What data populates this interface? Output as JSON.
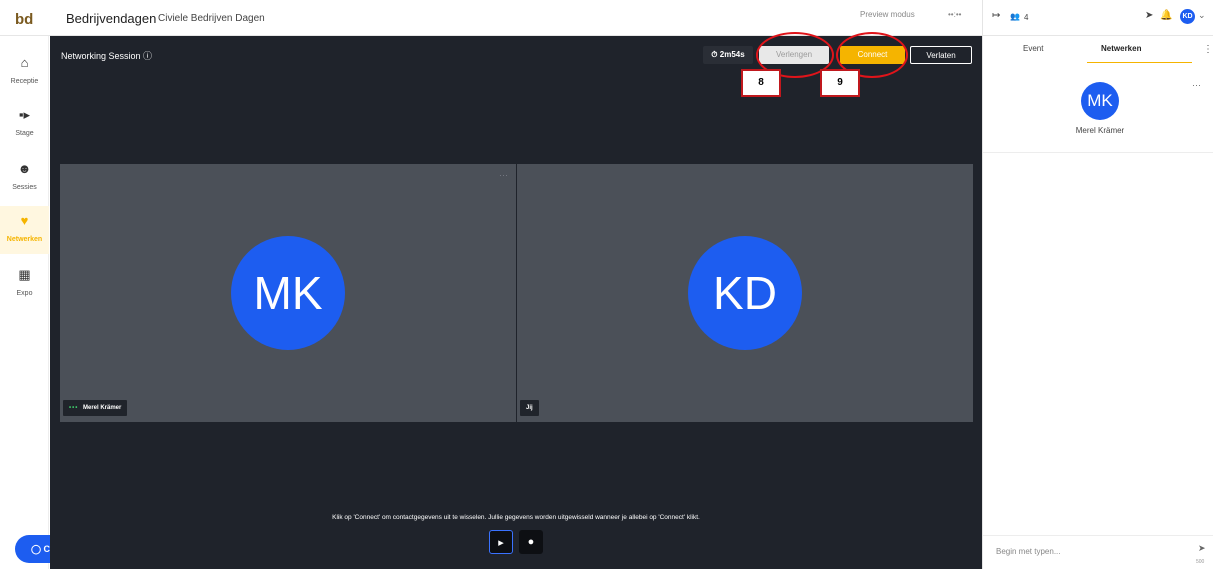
{
  "topbar": {
    "logo_text": "bd",
    "app_title": "Bedrijvendagen",
    "event_name": "Civiele Bedrijven Dagen",
    "preview_label": "Preview modus",
    "preview_toggle": "••:••",
    "attendee_count": "4",
    "avatar_initials": "KD"
  },
  "sidebar": {
    "items": [
      {
        "label": "Receptie",
        "icon": "home-icon"
      },
      {
        "label": "Stage",
        "icon": "video-camera-icon"
      },
      {
        "label": "Sessies",
        "icon": "people-icon"
      },
      {
        "label": "Netwerken",
        "icon": "handshake-icon"
      },
      {
        "label": "Expo",
        "icon": "store-icon"
      }
    ]
  },
  "session": {
    "title": "Networking Session ⓘ",
    "timer": "2m54s",
    "extend_label": "Verlengen",
    "connect_label": "Connect",
    "leave_label": "Verlaten"
  },
  "callouts": [
    "8",
    "9"
  ],
  "tiles": [
    {
      "initials": "MK",
      "name": "Merel Krämer"
    },
    {
      "initials": "KD",
      "name": "Jij"
    }
  ],
  "info_text": "Klik op 'Connect' om contactgegevens uit te wisselen. Jullie gegevens worden uitgewisseld wanneer je allebei op 'Connect' klikt.",
  "chat_label": "Chatten",
  "right_panel": {
    "tabs": [
      "Event",
      "Netwerken"
    ],
    "active_tab": "Netwerken",
    "contact_initials": "MK",
    "contact_name": "Merel Krämer",
    "input_placeholder": "Begin met typen...",
    "char_count": "500"
  },
  "colors": {
    "accent": "#f5b400",
    "brand_blue": "#1d5df0",
    "stage_bg": "#1f232b",
    "tile_bg": "#4b5058",
    "callout_red": "#e0141a"
  }
}
